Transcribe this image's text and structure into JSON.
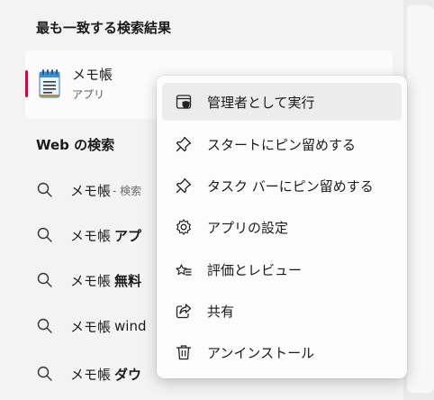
{
  "best_match": {
    "title": "最も一致する検索結果",
    "app_name": "メモ帳",
    "app_type": "アプリ",
    "accent_color": "#b3134c"
  },
  "web_search": {
    "title": "Web の検索",
    "items": [
      {
        "query": "メモ帳",
        "suffix": "- 検索",
        "suffix_style": "light"
      },
      {
        "query": "メモ帳",
        "suffix": "アプ",
        "suffix_style": "bold"
      },
      {
        "query": "メモ帳",
        "suffix": "無料",
        "suffix_style": "bold"
      },
      {
        "query": "メモ帳",
        "suffix": "wind",
        "suffix_style": "plain"
      },
      {
        "query": "メモ帳",
        "suffix": "ダウ",
        "suffix_style": "bold"
      }
    ]
  },
  "context_menu": {
    "items": [
      {
        "label": "管理者として実行",
        "icon": "admin-shield-icon",
        "highlighted": true
      },
      {
        "label": "スタートにピン留めする",
        "icon": "pin-icon"
      },
      {
        "label": "タスク バーにピン留めする",
        "icon": "pin-icon"
      },
      {
        "label": "アプリの設定",
        "icon": "gear-icon"
      },
      {
        "label": "評価とレビュー",
        "icon": "star-list-icon"
      },
      {
        "label": "共有",
        "icon": "share-icon"
      },
      {
        "label": "アンインストール",
        "icon": "trash-icon"
      }
    ]
  }
}
